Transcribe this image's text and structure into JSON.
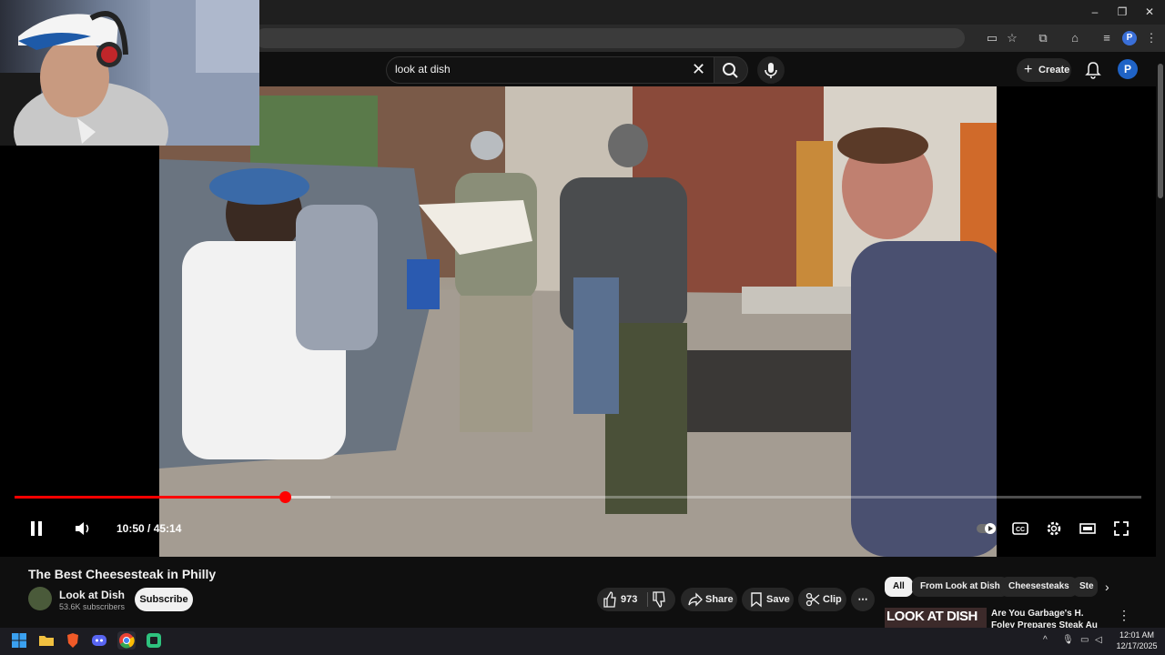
{
  "browser": {
    "window_controls": [
      "–",
      "❐",
      "✕"
    ],
    "profile_initial": "P"
  },
  "youtube": {
    "search": {
      "value": "look at dish"
    },
    "create_label": "Create",
    "avatar_initial": "P"
  },
  "player": {
    "time_readout": "10:50 / 45:14",
    "progress_fraction": 0.2398,
    "buffer_fraction": 0.28,
    "playing": true
  },
  "video_info": {
    "title": "The Best Cheesesteak in Philly",
    "channel": "Look at Dish",
    "subscribers": "53.6K subscribers",
    "subscribe_label": "Subscribe",
    "like_count": "973",
    "share_label": "Share",
    "save_label": "Save",
    "clip_label": "Clip"
  },
  "chips": [
    "All",
    "From Look at Dish",
    "Cheesesteaks",
    "Ste"
  ],
  "recommendation": {
    "thumb_text": "LOOK AT DISH",
    "title": "Are You Garbage's H. Foley Prepares Steak Au Poivre - Lo..."
  },
  "taskbar": {
    "time": "12:01 AM",
    "date": "12/17/2025"
  },
  "colors": {
    "accent": "#ff0000",
    "background": "#0f0f0f",
    "pill": "#272727"
  }
}
